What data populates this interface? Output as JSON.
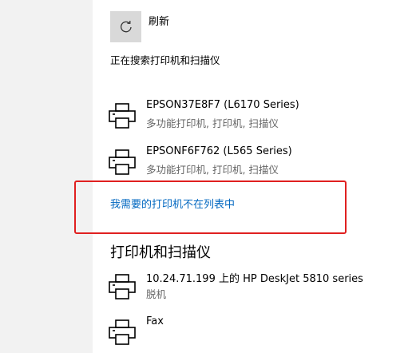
{
  "refresh": {
    "label": "刷新",
    "icon": "refresh-icon"
  },
  "status_text": "正在搜索打印机和扫描仪",
  "found_printers": [
    {
      "name": "EPSON37E8F7 (L6170 Series)",
      "description": "多功能打印机, 打印机, 扫描仪",
      "icon": "printer-icon"
    },
    {
      "name": "EPSONF6F762 (L565 Series)",
      "description": "多功能打印机, 打印机, 扫描仪",
      "icon": "printer-icon"
    }
  ],
  "not_listed_link": "我需要的打印机不在列表中",
  "section_title": "打印机和扫描仪",
  "installed_printers": [
    {
      "name": "10.24.71.199 上的 HP DeskJet 5810 series",
      "status": "脱机",
      "icon": "printer-icon"
    },
    {
      "name": "Fax",
      "status": "",
      "icon": "printer-icon"
    }
  ],
  "colors": {
    "link": "#0067c0",
    "highlight": "#e02020",
    "secondary_text": "#666666",
    "tile": "#d9d9d9"
  }
}
